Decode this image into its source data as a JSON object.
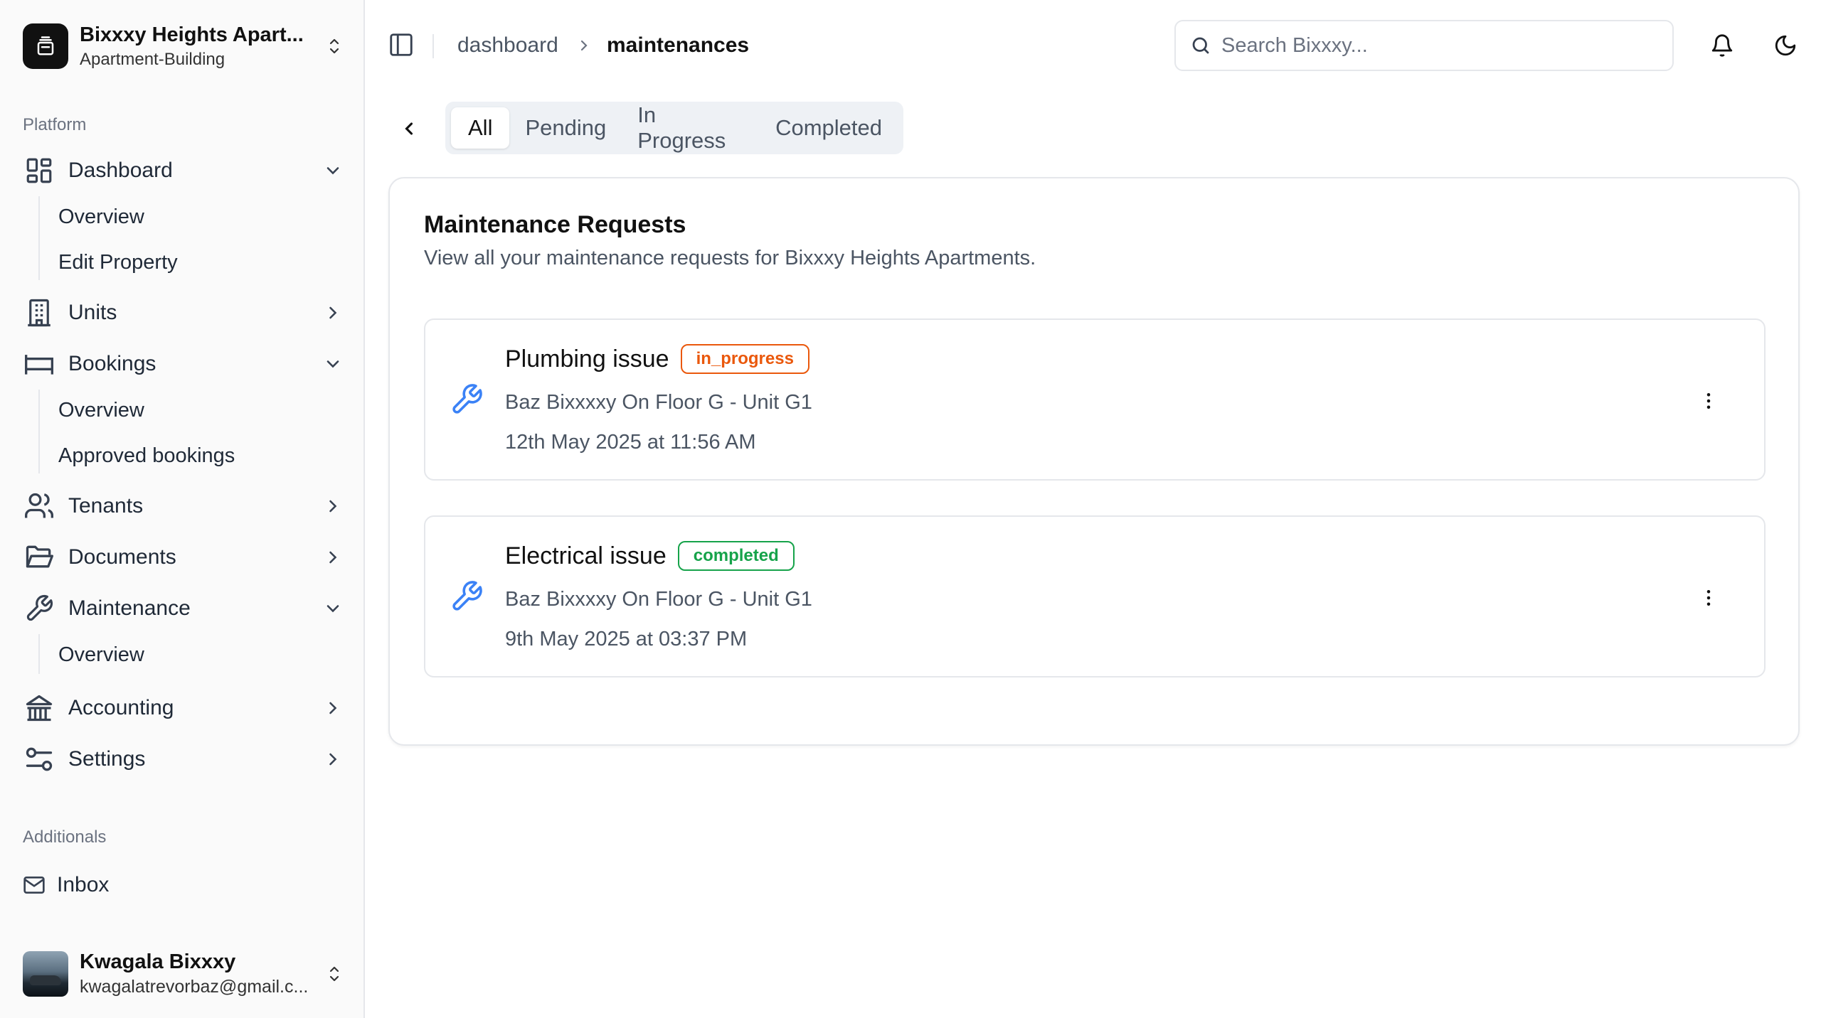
{
  "sidebar": {
    "org": {
      "name": "Bixxxy Heights Apart...",
      "type": "Apartment-Building"
    },
    "platform_label": "Platform",
    "nav": [
      {
        "label": "Dashboard",
        "icon": "grid-icon",
        "expanded": true,
        "children": [
          "Overview",
          "Edit Property"
        ]
      },
      {
        "label": "Units",
        "icon": "building-icon",
        "expanded": false
      },
      {
        "label": "Bookings",
        "icon": "bed-icon",
        "expanded": true,
        "children": [
          "Overview",
          "Approved bookings"
        ]
      },
      {
        "label": "Tenants",
        "icon": "users-icon",
        "expanded": false
      },
      {
        "label": "Documents",
        "icon": "folder-icon",
        "expanded": false
      },
      {
        "label": "Maintenance",
        "icon": "wrench-icon",
        "expanded": true,
        "children": [
          "Overview"
        ]
      },
      {
        "label": "Accounting",
        "icon": "bank-icon",
        "expanded": false
      },
      {
        "label": "Settings",
        "icon": "sliders-icon",
        "expanded": false
      }
    ],
    "additionals_label": "Additionals",
    "inbox_label": "Inbox",
    "user": {
      "name": "Kwagala Bixxxy",
      "email": "kwagalatrevorbaz@gmail.c..."
    }
  },
  "header": {
    "breadcrumb": [
      "dashboard",
      "maintenances"
    ],
    "search_placeholder": "Search Bixxxy..."
  },
  "tabs": [
    "All",
    "Pending",
    "In Progress",
    "Completed"
  ],
  "active_tab": "All",
  "card": {
    "title": "Maintenance Requests",
    "description": "View all your maintenance requests for Bixxxy Heights Apartments."
  },
  "requests": [
    {
      "title": "Plumbing issue",
      "status": "in_progress",
      "location": "Baz Bixxxxy On Floor G - Unit G1",
      "date": "12th May 2025 at 11:56 AM"
    },
    {
      "title": "Electrical issue",
      "status": "completed",
      "location": "Baz Bixxxxy On Floor G - Unit G1",
      "date": "9th May 2025 at 03:37 PM"
    }
  ],
  "colors": {
    "accent_icon": "#3b82f6",
    "in_progress": "#ea580c",
    "completed": "#16a34a",
    "muted_text": "#4b5563"
  }
}
